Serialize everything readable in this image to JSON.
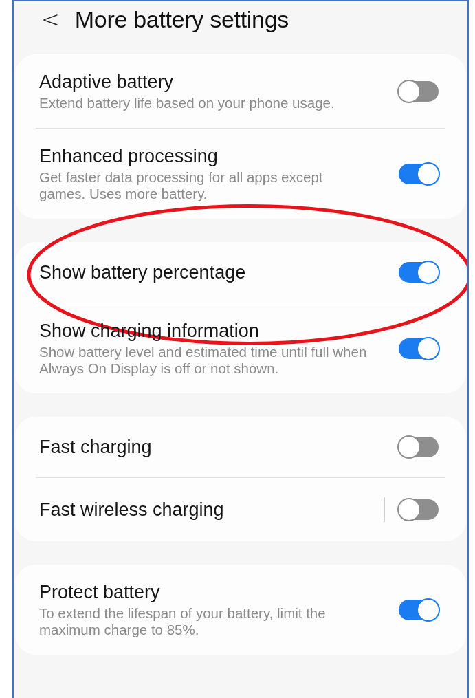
{
  "header": {
    "back": "<",
    "title": "More battery settings"
  },
  "groups": [
    {
      "items": [
        {
          "title": "Adaptive battery",
          "subtitle": "Extend battery life based on your phone usage.",
          "on": false,
          "separator": false,
          "highlighted": false
        },
        {
          "title": "Enhanced processing",
          "subtitle": "Get faster data processing for all apps except games. Uses more battery.",
          "on": true,
          "separator": false,
          "highlighted": false
        }
      ]
    },
    {
      "items": [
        {
          "title": "Show battery percentage",
          "on": true,
          "separator": false,
          "highlighted": true
        },
        {
          "title": "Show charging information",
          "subtitle": "Show battery level and estimated time until full when Always On Display is off or not shown.",
          "on": true,
          "separator": false,
          "highlighted": false
        }
      ]
    },
    {
      "items": [
        {
          "title": "Fast charging",
          "on": false,
          "separator": false,
          "highlighted": false
        },
        {
          "title": "Fast wireless charging",
          "on": false,
          "separator": true,
          "highlighted": false
        }
      ]
    },
    {
      "items": [
        {
          "title": "Protect battery",
          "subtitle": "To extend the lifespan of your battery, limit the maximum charge to 85%.",
          "on": true,
          "separator": false,
          "highlighted": false
        }
      ]
    }
  ]
}
